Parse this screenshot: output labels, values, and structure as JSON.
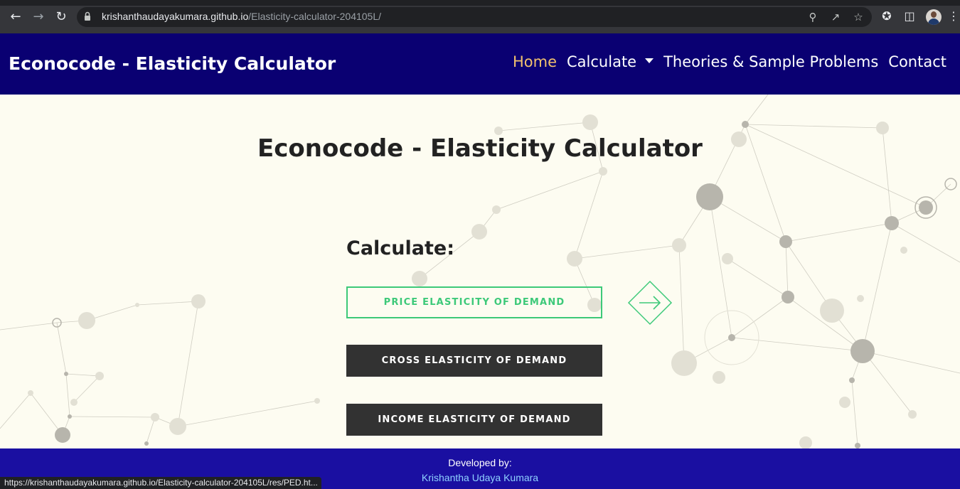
{
  "browser": {
    "url_host": "krishanthaudayakumara.github.io",
    "url_path": "/Elasticity-calculator-204105L/",
    "status_url": "https://krishanthaudayakumara.github.io/Elasticity-calculator-204105L/res/PED.ht...",
    "icons": [
      "back-icon",
      "forward-icon",
      "reload-icon",
      "lock-icon",
      "zoom-icon",
      "share-icon",
      "star-icon",
      "extensions-icon",
      "side-panel-icon",
      "avatar",
      "menu-icon"
    ]
  },
  "navbar": {
    "brand": "Econocode - Elasticity Calculator",
    "links": {
      "home": "Home",
      "calculate": "Calculate",
      "theories": "Theories & Sample Problems",
      "contact": "Contact"
    },
    "active_color": "#f1c16e",
    "bg_color": "#0a0072"
  },
  "main": {
    "title": "Econocode - Elasticity Calculator",
    "calculate_label": "Calculate:",
    "buttons": {
      "ped": "PRICE ELASTICITY OF DEMAND",
      "xed": "CROSS ELASTICITY OF DEMAND",
      "yed": "INCOME ELASTICITY OF DEMAND"
    },
    "accent_color": "#3dc979"
  },
  "footer": {
    "developed_by": "Developed by:",
    "author": "Krishantha Udaya Kumara",
    "bg_color": "#1a0fa1"
  }
}
